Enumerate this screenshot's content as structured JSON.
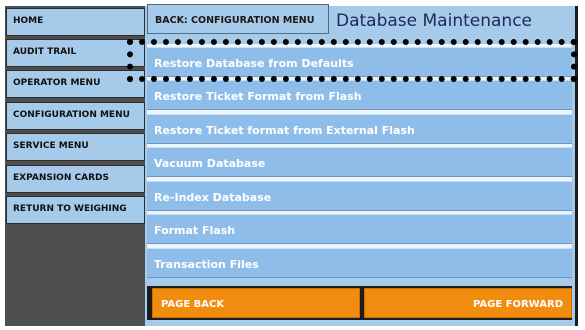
{
  "sidebar": {
    "items": [
      {
        "label": "HOME"
      },
      {
        "label": "AUDIT TRAIL"
      },
      {
        "label": "OPERATOR MENU"
      },
      {
        "label": "CONFIGURATION MENU"
      },
      {
        "label": "SERVICE MENU"
      },
      {
        "label": "EXPANSION CARDS"
      },
      {
        "label": "RETURN TO WEIGHING"
      }
    ]
  },
  "header": {
    "back_label": "BACK: CONFIGURATION MENU",
    "title": "Database Maintenance"
  },
  "menu": {
    "items": [
      {
        "label": "Restore Database from Defaults",
        "selected": true
      },
      {
        "label": "Restore Ticket Format from Flash"
      },
      {
        "label": "Restore Ticket format from External Flash"
      },
      {
        "label": "Vacuum Database"
      },
      {
        "label": "Re-Index Database"
      },
      {
        "label": "Format Flash"
      },
      {
        "label": "Transaction Files"
      }
    ]
  },
  "footer": {
    "page_back_label": "PAGE BACK",
    "page_forward_label": "PAGE FORWARD"
  },
  "colors": {
    "panel": "#a6cbea",
    "row": "#8fbde9",
    "accent_orange": "#f18c0f",
    "dark": "#1c1c1c",
    "title_text": "#1c2a55"
  }
}
